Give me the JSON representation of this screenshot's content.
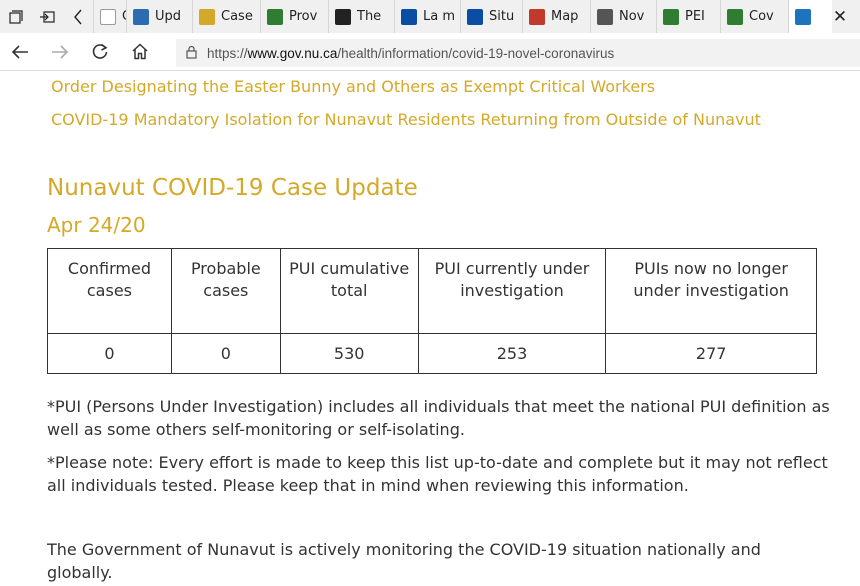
{
  "browser": {
    "tabs": [
      {
        "label": "Case",
        "icon": "page-icon",
        "color": "#ffffff"
      },
      {
        "label": "Upd",
        "icon": "chart-icon",
        "color": "#2b6cb0"
      },
      {
        "label": "Case",
        "icon": "document-icon",
        "color": "#d4a929"
      },
      {
        "label": "Prov",
        "icon": "bc-flag-icon",
        "color": "#2e7d32"
      },
      {
        "label": "The",
        "icon": "shield-icon",
        "color": "#222222"
      },
      {
        "label": "La m",
        "icon": "quebec-flag-icon",
        "color": "#0a4ea3"
      },
      {
        "label": "Situ",
        "icon": "quebec-flag-icon",
        "color": "#0a4ea3"
      },
      {
        "label": "Map",
        "icon": "map-icon",
        "color": "#c0392b"
      },
      {
        "label": "Nov",
        "icon": "nova-scotia-icon",
        "color": "#555555"
      },
      {
        "label": "PEI",
        "icon": "pei-icon",
        "color": "#2e7d32"
      },
      {
        "label": "Cov",
        "icon": "globe-icon",
        "color": "#2e7d32"
      },
      {
        "label": "",
        "icon": "nunavut-icon",
        "color": "#1e73be"
      }
    ],
    "url_prefix": "https://",
    "url_domain": "www.gov.nu.ca",
    "url_path": "/health/information/covid-19-novel-coronavirus"
  },
  "page": {
    "links": [
      "Order Designating the Easter Bunny and Others as Exempt Critical Workers",
      "COVID-19 Mandatory Isolation for Nunavut Residents Returning from Outside of Nunavut"
    ],
    "title": "Nunavut COVID-19 Case Update",
    "date": "Apr 24/20",
    "table": {
      "headers": [
        "Confirmed cases",
        "Probable cases",
        "PUI cumulative total",
        "PUI currently under investigation",
        "PUIs now no longer under investigation"
      ],
      "values": [
        "0",
        "0",
        "530",
        "253",
        "277"
      ]
    },
    "note_pui": "*PUI (Persons Under Investigation) includes all individuals that meet the national PUI definition as well as some others self-monitoring or self-isolating.",
    "note_please": "*Please note: Every effort is made to keep this list up-to-date and complete but it may not reflect all individuals tested. Please keep that in mind when reviewing this information.",
    "monitoring": "The Government of Nunavut is actively monitoring the COVID-19 situation nationally and globally."
  },
  "colors": {
    "accent": "#d4a929",
    "text": "#333333"
  }
}
